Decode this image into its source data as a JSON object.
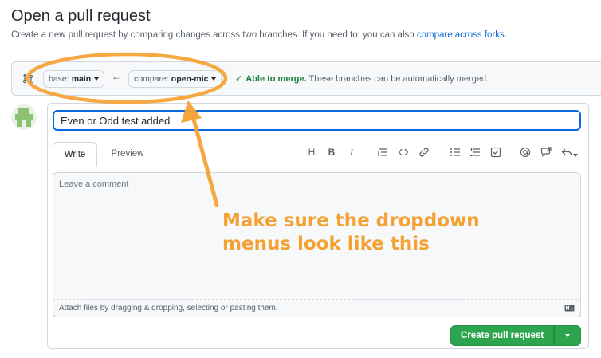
{
  "header": {
    "title": "Open a pull request",
    "subtitle": "Create a new pull request by comparing changes across two branches. If you need to, you can also ",
    "subtitle_link": "compare across forks",
    "subtitle_end": "."
  },
  "compare": {
    "base_label": "base:",
    "base_value": "main",
    "compare_label": "compare:",
    "compare_value": "open-mic",
    "merge_ok": "Able to merge.",
    "merge_text": "These branches can be automatically merged."
  },
  "form": {
    "title_value": "Even or Odd test added",
    "tab_write": "Write",
    "tab_preview": "Preview",
    "toolbar": [
      "H",
      "B",
      "I",
      "quote-icon",
      "code-icon",
      "link-icon",
      "unordered-list-icon",
      "ordered-list-icon",
      "task-list-icon",
      "mention-icon",
      "reference-icon",
      "reply-icon"
    ],
    "comment_placeholder": "Leave a comment",
    "attach_text": "Attach files by dragging & dropping, selecting or pasting them.",
    "submit_label": "Create pull request"
  },
  "annotation": {
    "text": "Make sure the dropdown menus look like this",
    "color": "#f5a132"
  },
  "colors": {
    "accent_blue": "#0969da",
    "success_green": "#1a7f37",
    "button_green": "#2da44e"
  }
}
